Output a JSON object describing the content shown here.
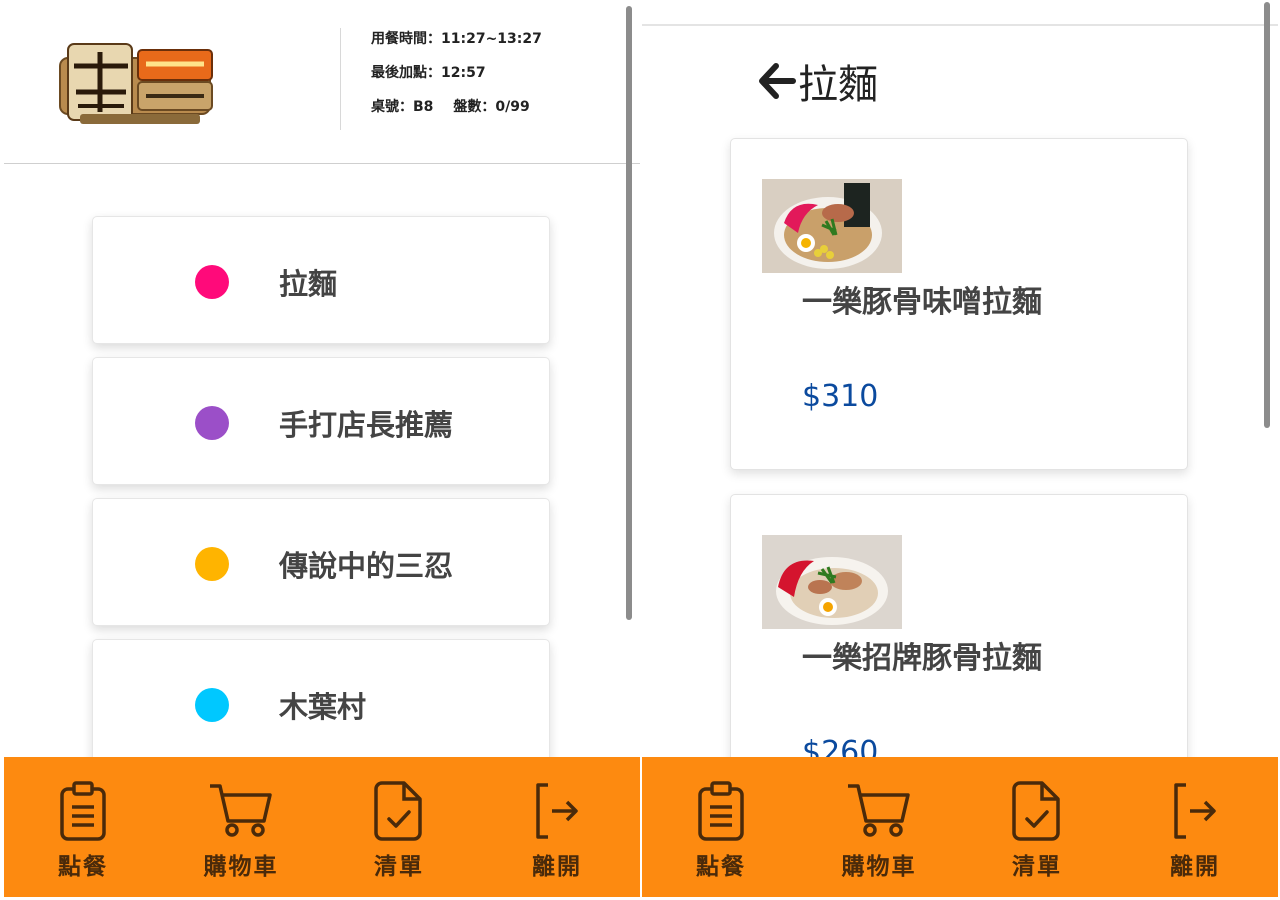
{
  "restaurant": {
    "dining_time": "用餐時間：11:27~13:27",
    "last_order": "最後加點：12:57",
    "table": "桌號：B8",
    "plates": "盤數：0/99"
  },
  "categories": [
    {
      "label": "拉麵",
      "color": "#ff0a7a"
    },
    {
      "label": "手打店長推薦",
      "color": "#9b4fc8"
    },
    {
      "label": "傳說中的三忍",
      "color": "#ffb400"
    },
    {
      "label": "木葉村",
      "color": "#00c8ff"
    }
  ],
  "detail": {
    "back_title": "拉麵",
    "items": [
      {
        "name": "一樂豚骨味噌拉麵",
        "price": "$310"
      },
      {
        "name": "一樂招牌豚骨拉麵",
        "price": "$260"
      }
    ]
  },
  "nav": {
    "order": "點餐",
    "cart": "購物車",
    "list": "清單",
    "leave": "離開"
  },
  "colors": {
    "nav_bg": "#fd8a10",
    "price": "#0b4a9e"
  }
}
